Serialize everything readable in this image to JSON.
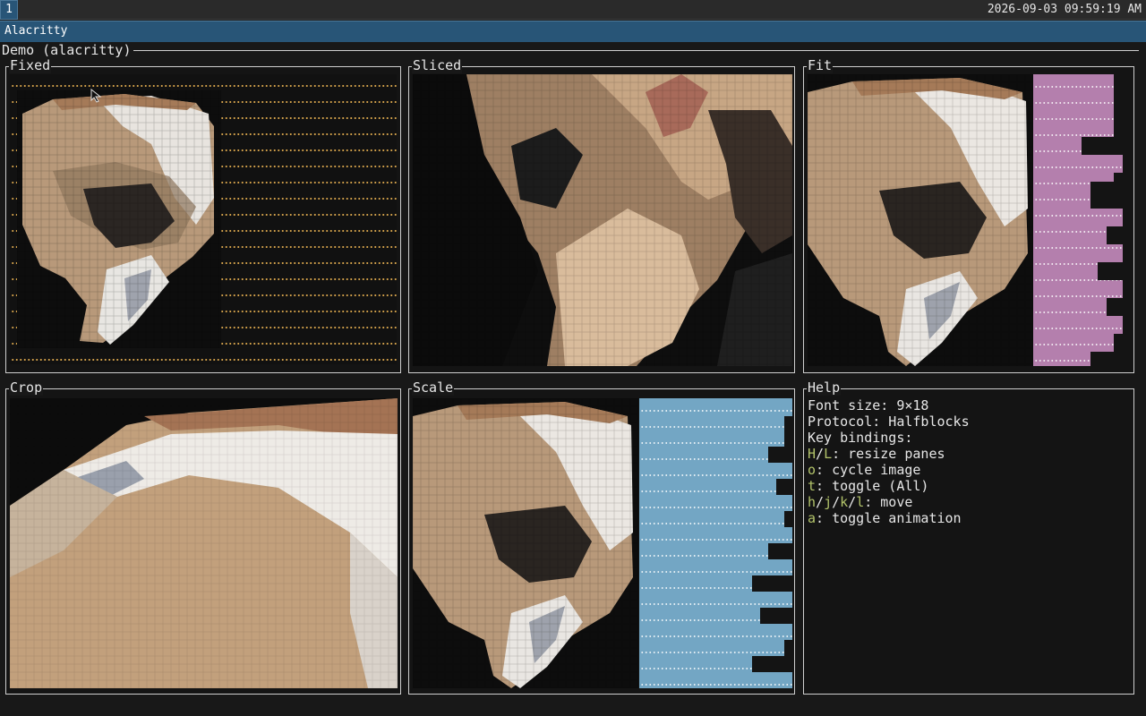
{
  "topbar": {
    "workspace": "1",
    "clock": "2026-09-03 09:59:19 AM"
  },
  "window": {
    "title": "Alacritty"
  },
  "app": {
    "title": "Demo (alacritty)",
    "panes": {
      "fixed": "Fixed",
      "sliced": "Sliced",
      "fit": "Fit",
      "crop": "Crop",
      "scale": "Scale",
      "help": "Help"
    },
    "help": {
      "font_size": "Font size: 9×18",
      "protocol": "Protocol: Halfblocks",
      "key_bindings": "Key bindings:",
      "bindings": [
        {
          "keys": [
            "H",
            "L"
          ],
          "desc": ": resize panes"
        },
        {
          "keys": [
            "o"
          ],
          "desc": ": cycle image"
        },
        {
          "keys": [
            "t"
          ],
          "desc": ": toggle (All)"
        },
        {
          "keys": [
            "h",
            "j",
            "k",
            "l"
          ],
          "desc": ": move"
        },
        {
          "keys": [
            "a"
          ],
          "desc": ": toggle animation"
        }
      ]
    }
  },
  "colors": {
    "title_bar": "#285577",
    "dots": "#d1a04a",
    "fit_background": "#b47fad",
    "scale_background": "#73a6c4",
    "key_highlight": "#b2c36a"
  },
  "icons": {
    "pointer": "mouse-pointer-icon"
  }
}
